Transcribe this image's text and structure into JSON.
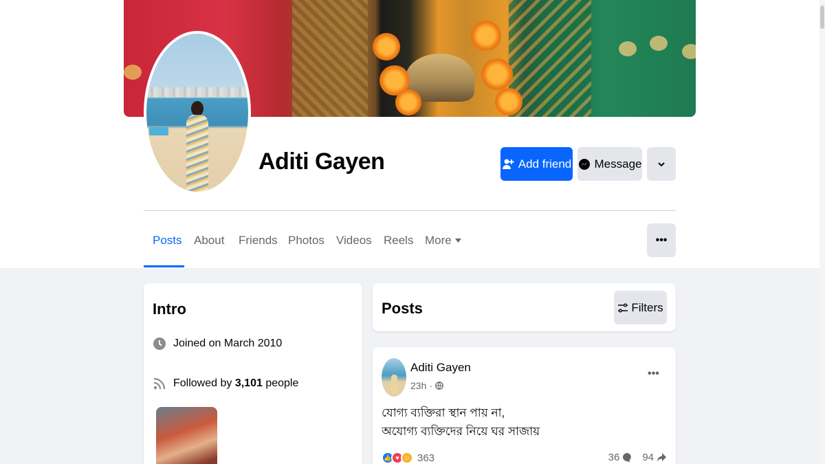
{
  "profile": {
    "name": "Aditi Gayen"
  },
  "actions": {
    "add_friend": "Add friend",
    "message": "Message",
    "more_icon": "chevron-down-icon"
  },
  "tabs": [
    {
      "label": "Posts",
      "active": true
    },
    {
      "label": "About"
    },
    {
      "label": "Friends"
    },
    {
      "label": "Photos"
    },
    {
      "label": "Videos"
    },
    {
      "label": "Reels"
    },
    {
      "label": "More"
    }
  ],
  "intro": {
    "title": "Intro",
    "joined": "Joined on March 2010",
    "followed_prefix": "Followed by ",
    "followed_count": "3,101",
    "followed_suffix": " people"
  },
  "posts": {
    "title": "Posts",
    "filters_label": "Filters"
  },
  "post": {
    "author": "Aditi Gayen",
    "time": "23h",
    "separator": "·",
    "audience_icon": "globe-icon",
    "line1": "যোগ্য ব্যক্তিরা স্থান পায় না,",
    "line2": "অযোগ্য ব্যক্তিদের নিয়ে ঘর সাজায়",
    "reaction_count": "363",
    "comment_count": "36",
    "share_count": "94"
  },
  "colors": {
    "primary": "#0866ff",
    "secondary_button": "#e4e6eb",
    "background": "#f0f2f5",
    "muted_text": "#65676b"
  }
}
